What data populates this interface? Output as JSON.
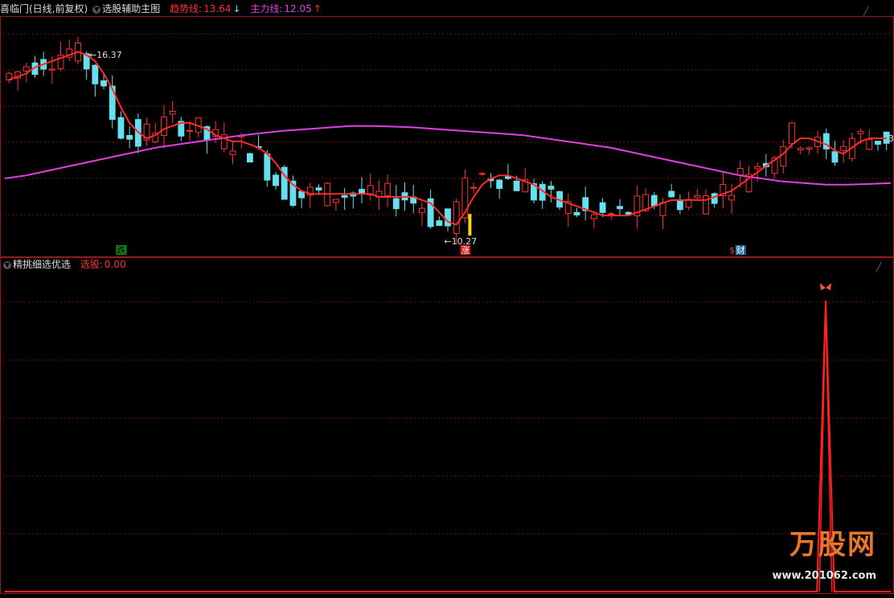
{
  "main_header": {
    "stock": "喜临门(日线,前复权)",
    "indicator": "选股辅助主图",
    "trend_label": "趋势线:",
    "trend_value": "13.64",
    "trend_arrow": "↓",
    "main_label": "主力线:",
    "main_value": "12.05",
    "main_arrow": "↑"
  },
  "sub_header": {
    "indicator": "精挑细选优选",
    "pick_label": "选股:",
    "pick_value": "0.00"
  },
  "colors": {
    "trend": "#ff2a2a",
    "main_line": "#e040e0",
    "up_candle": "#ff3333",
    "down_candle": "#66e0ee",
    "grid": "#7a1010",
    "border": "#9a1a1a",
    "highlight": "#ffd21a"
  },
  "annotations": {
    "high_label": "16.37",
    "low_label": "10.27",
    "marker_die": "跌",
    "marker_zhang": "涨",
    "marker_cai": "财",
    "marker_dollar": "$",
    "right_edge_value": "3"
  },
  "watermark": {
    "title": "万股网",
    "url": "www.201062.com"
  },
  "chart_data": [
    {
      "type": "candlestick",
      "panel": "main",
      "ylim": [
        9.7,
        17.2
      ],
      "high": 16.37,
      "low": 10.27,
      "series": [
        {
          "name": "趋势线",
          "last": 13.64
        },
        {
          "name": "主力线",
          "last": 12.05
        }
      ],
      "trend_line": [
        15.4,
        15.5,
        15.6,
        15.8,
        15.9,
        16.0,
        16.1,
        16.2,
        16.3,
        16.2,
        16.0,
        15.6,
        15.1,
        14.5,
        14.0,
        13.7,
        13.5,
        13.6,
        13.8,
        13.9,
        14.0,
        14.0,
        13.9,
        13.8,
        13.6,
        13.5,
        13.4,
        13.4,
        13.3,
        13.2,
        13.0,
        12.7,
        12.3,
        12.0,
        11.8,
        11.7,
        11.7,
        11.7,
        11.7,
        11.7,
        11.7,
        11.7,
        11.7,
        11.6,
        11.6,
        11.6,
        11.6,
        11.6,
        11.5,
        11.4,
        11.1,
        10.8,
        10.7,
        11.1,
        11.6,
        12.0,
        12.2,
        12.3,
        12.3,
        12.2,
        12.1,
        12.0,
        11.8,
        11.6,
        11.5,
        11.4,
        11.3,
        11.2,
        11.1,
        11.0,
        11.0,
        11.0,
        11.0,
        11.1,
        11.2,
        11.3,
        11.4,
        11.5,
        11.5,
        11.5,
        11.5,
        11.5,
        11.6,
        11.7,
        11.8,
        12.0,
        12.2,
        12.4,
        12.6,
        12.8,
        13.0,
        13.3,
        13.5,
        13.5,
        13.4,
        13.3,
        13.1,
        13.0,
        13.2,
        13.4,
        13.5,
        13.5,
        13.5
      ],
      "main_line": [
        12.2,
        12.3,
        12.45,
        12.6,
        12.75,
        12.9,
        13.05,
        13.2,
        13.3,
        13.4,
        13.5,
        13.6,
        13.68,
        13.75,
        13.8,
        13.85,
        13.9,
        13.9,
        13.88,
        13.85,
        13.8,
        13.75,
        13.7,
        13.65,
        13.6,
        13.5,
        13.4,
        13.3,
        13.2,
        13.05,
        12.9,
        12.75,
        12.6,
        12.45,
        12.3,
        12.2,
        12.1,
        12.05,
        12.0,
        12.0,
        12.02,
        12.05
      ],
      "highlight_bar": {
        "index": 53,
        "low": 10.35,
        "high": 11.05
      },
      "markers": [
        {
          "text": "跌",
          "index": 13
        },
        {
          "text": "涨",
          "index": 53
        },
        {
          "text": "$",
          "index": 84
        },
        {
          "text": "财",
          "index": 85
        }
      ]
    },
    {
      "type": "line",
      "panel": "sub",
      "series": [
        {
          "name": "选股",
          "last": 0.0
        }
      ],
      "ylim": [
        0,
        1.1
      ],
      "spike": {
        "index": 94,
        "value": 1.0
      },
      "count": 102
    }
  ]
}
